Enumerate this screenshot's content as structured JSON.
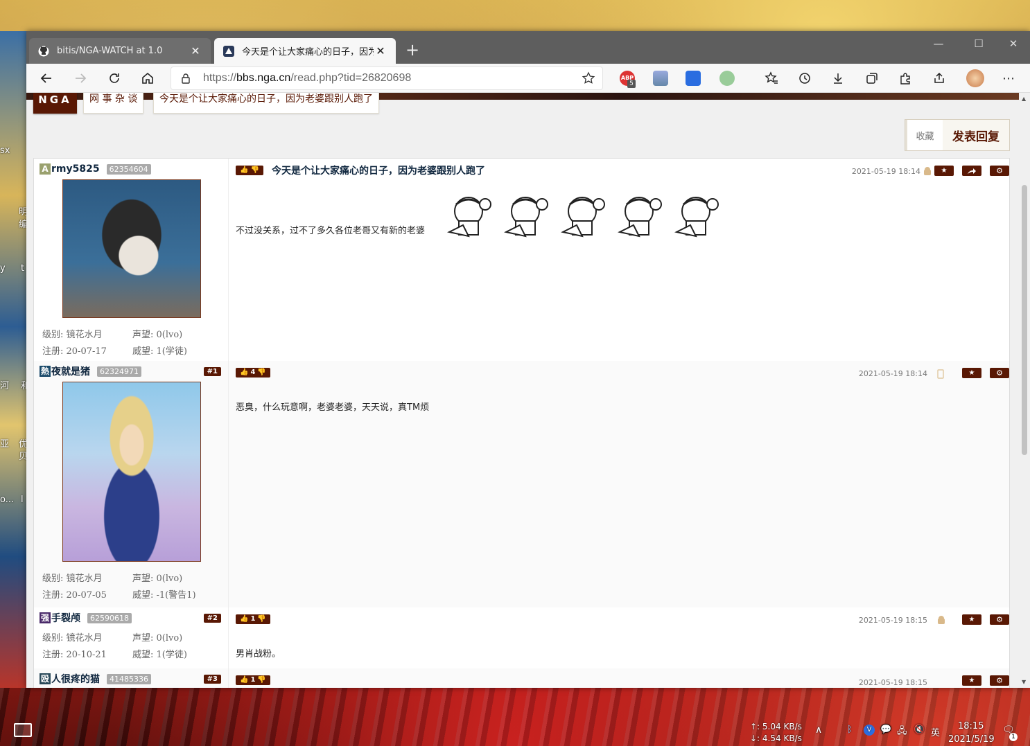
{
  "desktop": {
    "side_labels": [
      "sx",
      "明",
      "编",
      "y",
      "t",
      "河",
      "和",
      "亚",
      "优",
      "贝",
      "o...",
      "l"
    ]
  },
  "browser": {
    "tabs": [
      {
        "title": "bitis/NGA-WATCH at 1.0",
        "icon": "github-icon",
        "active": false
      },
      {
        "title": "今天是个让大家痛心的日子，因为",
        "icon": "nga-icon",
        "active": true
      }
    ],
    "url_prefix": "https://",
    "url_host": "bbs.nga.cn",
    "url_path": "/read.php?tid=26820698",
    "ext_badge": "5"
  },
  "page": {
    "logo": "NGA",
    "crumbs": [
      "网 事 杂 谈",
      "今天是个让大家痛心的日子，因为老婆跟别人跑了"
    ],
    "fav_label": "收藏",
    "reply_label": "发表回复",
    "posts": [
      {
        "initial": "A",
        "name": "rmy5825",
        "uid": "62354604",
        "floor": "",
        "votes": "",
        "title": "今天是个让大家痛心的日子，因为老婆跟别人跑了",
        "date": "2021-05-19 18:14",
        "text": "不过没关系，过不了多久各位老哥又有新的老婆",
        "level": "级别: 镜花水月",
        "rep": "声望: 0(lvo)",
        "reg": "注册: 20-07-17",
        "prestige": "威望: 1(学徒)"
      },
      {
        "initial": "熱",
        "name": "夜就是猪",
        "uid": "62324971",
        "floor": "#1",
        "votes": "4",
        "title": "",
        "date": "2021-05-19 18:14",
        "text": "恶臭，什么玩意啊，老婆老婆，天天说，真TM烦",
        "level": "级别: 镜花水月",
        "rep": "声望: 0(lvo)",
        "reg": "注册: 20-07-05",
        "prestige": "威望: -1(警告1)"
      },
      {
        "initial": "强",
        "name": "手裂颅",
        "uid": "62590618",
        "floor": "#2",
        "votes": "1",
        "title": "",
        "date": "2021-05-19 18:15",
        "text": "男肖战粉。",
        "level": "级别: 镜花水月",
        "rep": "声望: 0(lvo)",
        "reg": "注册: 20-10-21",
        "prestige": "威望: 1(学徒)"
      },
      {
        "initial": "殴",
        "name": "人很疼的猫",
        "uid": "41485336",
        "floor": "#3",
        "votes": "1",
        "title": "",
        "date": "2021-05-19 18:15",
        "text": "",
        "level": "",
        "rep": "",
        "reg": "",
        "prestige": ""
      }
    ]
  },
  "taskbar": {
    "up_speed": "↑: 5.04 KB/s",
    "down_speed": "↓: 4.54 KB/s",
    "ime": "英",
    "time": "18:15",
    "date": "2021/5/19",
    "notif_count": "1"
  },
  "colors": {
    "nga_brown": "#591804",
    "tab_bar": "#5e5e5e",
    "toolbar": "#f7f7f7"
  }
}
